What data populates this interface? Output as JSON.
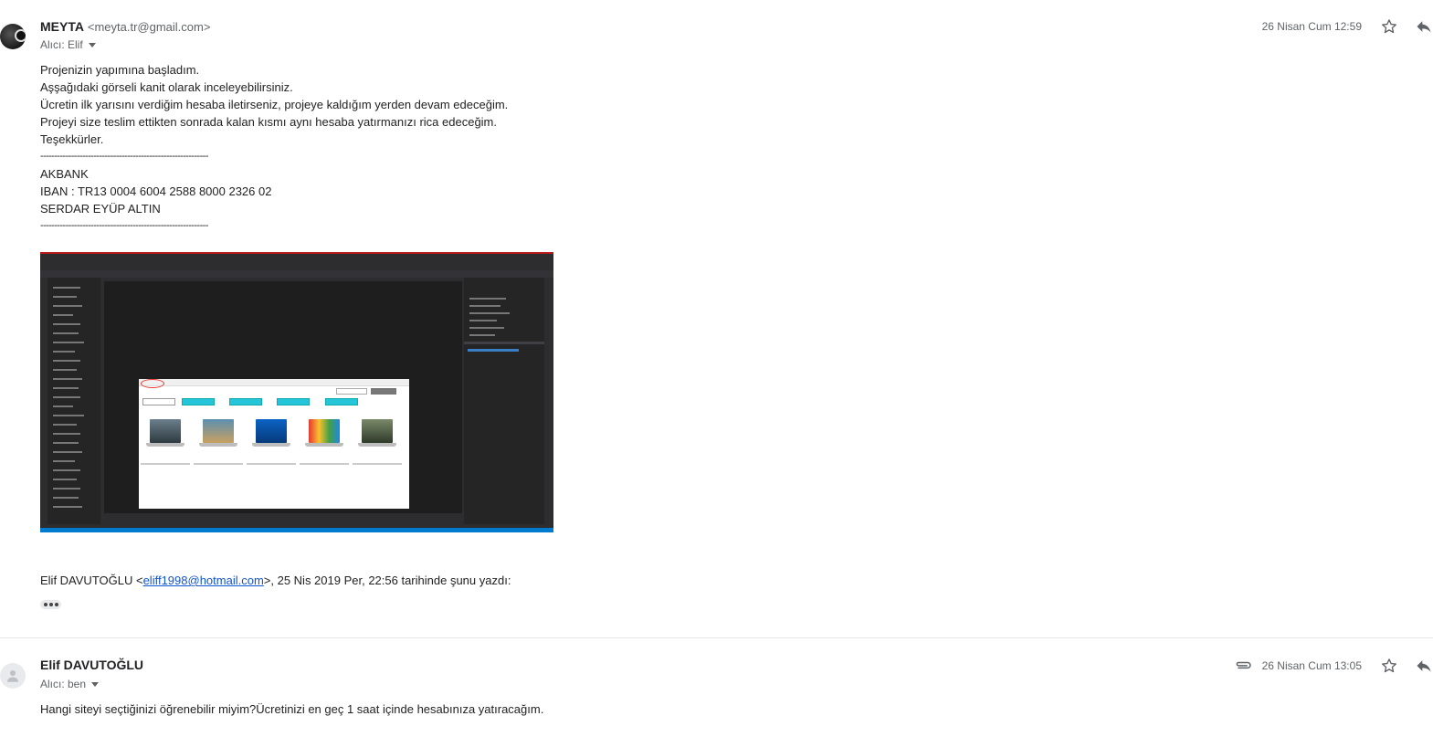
{
  "message1": {
    "sender_name": "MEYTA",
    "sender_email": "<meyta.tr@gmail.com>",
    "recipient": "Alıcı: Elif",
    "date": "26 Nisan Cum 12:59",
    "body_lines": [
      "Projenizin yapımına başladım.",
      "Aşşağıdaki görseli kanit olarak inceleyebilirsiniz.",
      "Ücretin ilk yarısını verdiğim hesaba iletirseniz, projeye kaldığım yerden devam edeceğim.",
      "Projeyi size teslim ettikten sonrada kalan kısmı aynı hesaba yatırmanızı rica edeceğim.",
      "Teşekkürler.",
      "------------------------------------------------------------",
      "AKBANK",
      "IBAN : TR13 0004 6004 2588 8000 2326 02",
      "SERDAR EYÜP ALTIN",
      "------------------------------------------------------------"
    ],
    "quote_prefix": "Elif DAVUTOĞLU <",
    "quote_email": "eliff1998@hotmail.com",
    "quote_suffix": ">, 25 Nis 2019 Per, 22:56 tarihinde şunu yazdı:",
    "icons": {
      "star": "star-icon",
      "reply": "reply-icon",
      "more": "ellipsis-icon"
    }
  },
  "message2": {
    "sender_name": "Elif DAVUTOĞLU",
    "recipient": "Alıcı: ben",
    "date": "26 Nisan Cum 13:05",
    "body": "Hangi siteyi seçtiğinizi öğrenebilir miyim?Ücretinizi en geç 1 saat içinde hesabınıza yatıracağım.",
    "icons": {
      "attachment": "paperclip-icon",
      "star": "star-icon",
      "reply": "reply-icon"
    }
  },
  "colors": {
    "link": "#1155cc",
    "secondary_text": "#5f6368",
    "vs_dark": "#2d2d30",
    "vs_blue": "#007acc",
    "teal_button": "#26c6da"
  }
}
